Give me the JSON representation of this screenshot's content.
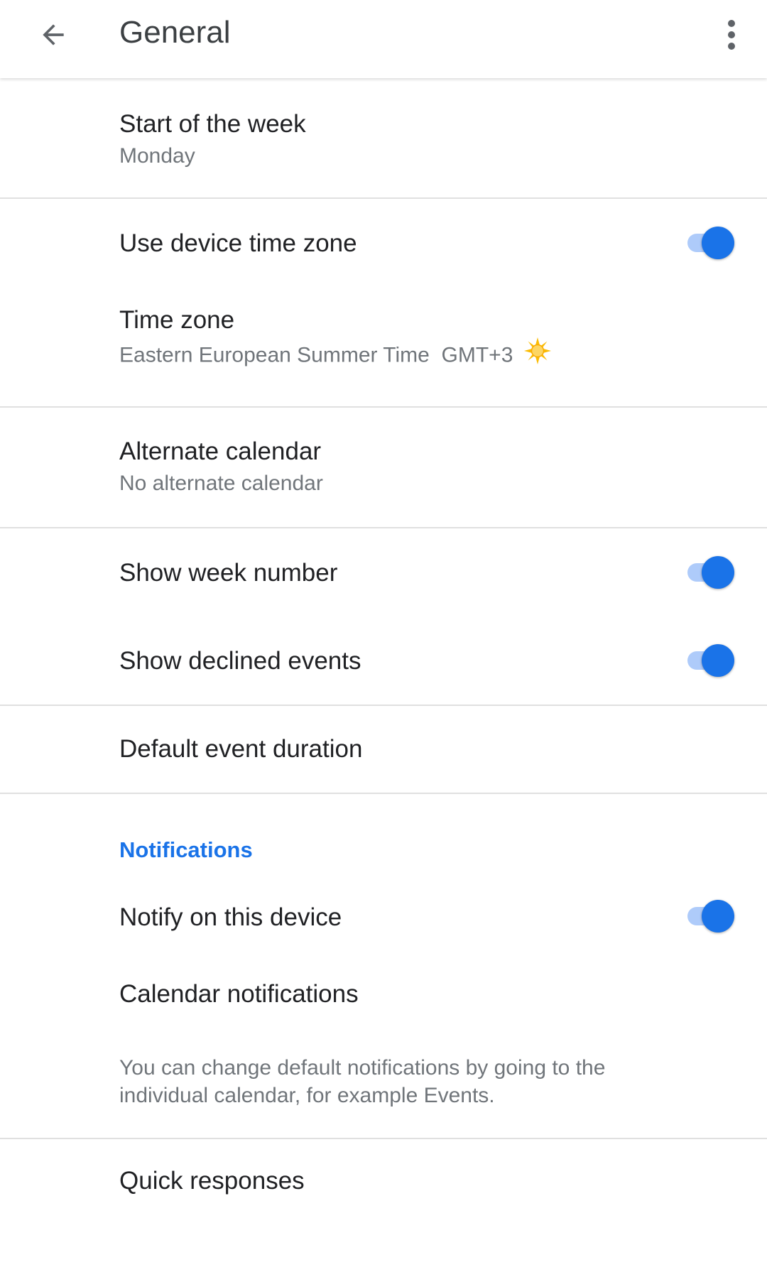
{
  "header": {
    "back_icon": "arrow-back-icon",
    "title": "General",
    "more_icon": "more-vert-icon"
  },
  "settings": {
    "start_of_week": {
      "title": "Start of the week",
      "value": "Monday"
    },
    "device_time_zone": {
      "title": "Use device time zone",
      "enabled": true
    },
    "time_zone": {
      "title": "Time zone",
      "value": "Eastern European Summer Time  GMT+3",
      "icon": "sun-icon"
    },
    "alternate_calendar": {
      "title": "Alternate calendar",
      "value": "No alternate calendar"
    },
    "show_week_number": {
      "title": "Show week number",
      "enabled": true
    },
    "show_declined_events": {
      "title": "Show declined events",
      "enabled": true
    },
    "default_event_duration": {
      "title": "Default event duration"
    }
  },
  "notifications": {
    "header": "Notifications",
    "notify_on_device": {
      "title": "Notify on this device",
      "enabled": true
    },
    "calendar_notifications": {
      "title": "Calendar notifications"
    },
    "hint": "You can change default notifications by going to the individual calendar, for example Events."
  },
  "quick_responses": {
    "title": "Quick responses"
  },
  "colors": {
    "accent": "#1a73e8",
    "switch_track": "#aecbfa",
    "primary_text": "#202124",
    "secondary_text": "#70757a",
    "divider": "#e0e0e0",
    "sun": "#fbbc04"
  }
}
